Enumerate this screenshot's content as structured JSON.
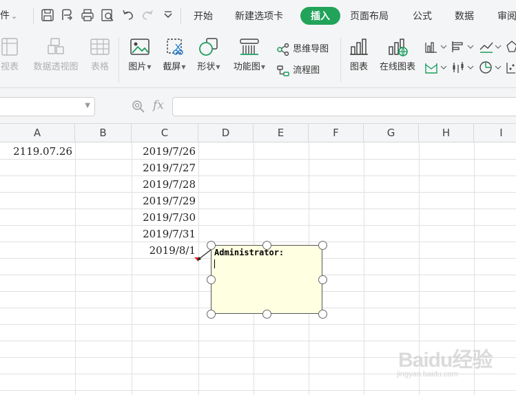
{
  "tabbar": {
    "file_menu": "件",
    "tabs": [
      "开始",
      "新建选项卡",
      "插入",
      "页面布局",
      "公式",
      "数据",
      "审阅"
    ],
    "active_tab": "插入"
  },
  "ribbon": {
    "pivot_table": "视表",
    "pivot_chart": "数据透视图",
    "table": "表格",
    "picture": "图片",
    "screenshot": "截屏",
    "shapes": "形状",
    "function_chart": "功能图",
    "mind_map": "思维导图",
    "flowchart": "流程图",
    "chart": "图表",
    "online_chart": "在线图表"
  },
  "formula_bar": {
    "fx": "fx",
    "value": ""
  },
  "columns": [
    "A",
    "B",
    "C",
    "D",
    "E",
    "F",
    "G",
    "H",
    "I"
  ],
  "cells": {
    "A1": "2119.07.26",
    "C": [
      "2019/7/26",
      "2019/7/27",
      "2019/7/28",
      "2019/7/29",
      "2019/7/30",
      "2019/7/31",
      "2019/8/1"
    ]
  },
  "comment": {
    "author": "Administrator:",
    "text": ""
  },
  "watermark": {
    "brand": "Baidu经验",
    "url": "jingyan.baidu.com"
  },
  "colors": {
    "active_tab": "#22a35a",
    "comment_bg": "#ffffe1",
    "comment_indicator": "#e02020"
  }
}
